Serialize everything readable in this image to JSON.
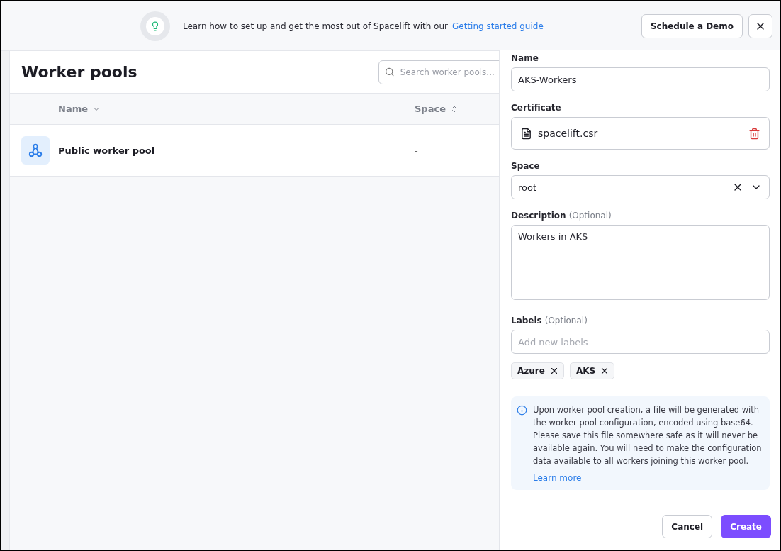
{
  "banner": {
    "text": "Learn how to set up and get the most out of Spacelift with our",
    "link": "Getting started guide",
    "demo_button": "Schedule a Demo"
  },
  "page": {
    "title": "Worker pools",
    "search": {
      "placeholder": "Search worker pools..."
    },
    "table": {
      "columns": [
        {
          "label": "Name",
          "sorted": true
        },
        {
          "label": "Space",
          "sorted": false
        }
      ],
      "rows": [
        {
          "name": "Public worker pool",
          "space": "-"
        }
      ]
    }
  },
  "drawer": {
    "name": {
      "label": "Name",
      "value": "AKS-Workers"
    },
    "certificate": {
      "label": "Certificate",
      "file": "spacelift.csr"
    },
    "space": {
      "label": "Space",
      "value": "root"
    },
    "description": {
      "label": "Description",
      "optional": "(Optional)",
      "value": "Workers in AKS"
    },
    "labels": {
      "label": "Labels",
      "optional": "(Optional)",
      "placeholder": "Add new labels",
      "chips": [
        "Azure",
        "AKS"
      ]
    },
    "info": {
      "text": "Upon worker pool creation, a file will be generated with the worker pool configuration, encoded using base64. Please save this file somewhere safe as it will never be available again. You will need to make the configuration data available to all workers joining this worker pool.",
      "link": "Learn more"
    },
    "buttons": {
      "cancel": "Cancel",
      "create": "Create"
    }
  }
}
